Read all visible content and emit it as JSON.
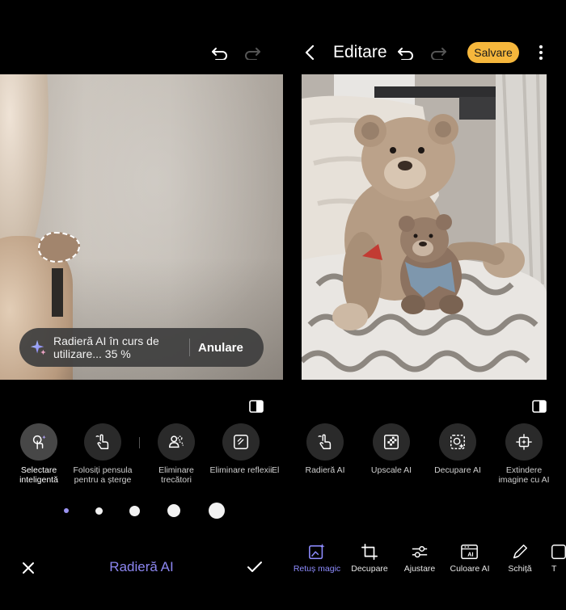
{
  "left_panel": {
    "progress_banner": {
      "text": "Radieră AI în curs de utilizare... 35 %",
      "cancel_label": "Anulare",
      "percent": 35
    },
    "tools": [
      {
        "label": "Selectare inteligentă",
        "icon": "smart-select-icon",
        "active": true
      },
      {
        "label": "Folosiți pensula pentru a șterge",
        "icon": "brush-erase-icon",
        "active": false
      },
      {
        "label": "Eliminare trecători",
        "icon": "remove-people-icon",
        "active": false
      },
      {
        "label": "Eliminare reflexii",
        "icon": "remove-reflections-icon",
        "active": false
      },
      {
        "label": "El",
        "icon": "",
        "active": false
      }
    ],
    "brush_sizes": [
      "xs",
      "s",
      "m",
      "l",
      "xl"
    ],
    "mode_title": "Radieră AI"
  },
  "right_panel": {
    "header": {
      "title": "Editare",
      "save_label": "Salvare"
    },
    "ai_tools": [
      {
        "label": "Radieră AI",
        "icon": "ai-eraser-icon"
      },
      {
        "label": "Upscale AI",
        "icon": "upscale-icon"
      },
      {
        "label": "Decupare AI",
        "icon": "ai-cutout-icon"
      },
      {
        "label": "Extindere imagine cu AI",
        "icon": "expand-image-icon"
      }
    ],
    "bottom_bar": [
      {
        "label": "Retuș magic",
        "icon": "magic-retouch-icon",
        "active": true
      },
      {
        "label": "Decupare",
        "icon": "crop-icon",
        "active": false
      },
      {
        "label": "Ajustare",
        "icon": "adjust-sliders-icon",
        "active": false
      },
      {
        "label": "Culoare AI",
        "icon": "ai-color-icon",
        "active": false
      },
      {
        "label": "Schiță",
        "icon": "sketch-pen-icon",
        "active": false
      },
      {
        "label": "T",
        "icon": "text-icon",
        "active": false
      }
    ]
  },
  "colors": {
    "accent_purple": "#8c86f0",
    "save_button_bg": "#f6b73c",
    "background": "#000000"
  }
}
